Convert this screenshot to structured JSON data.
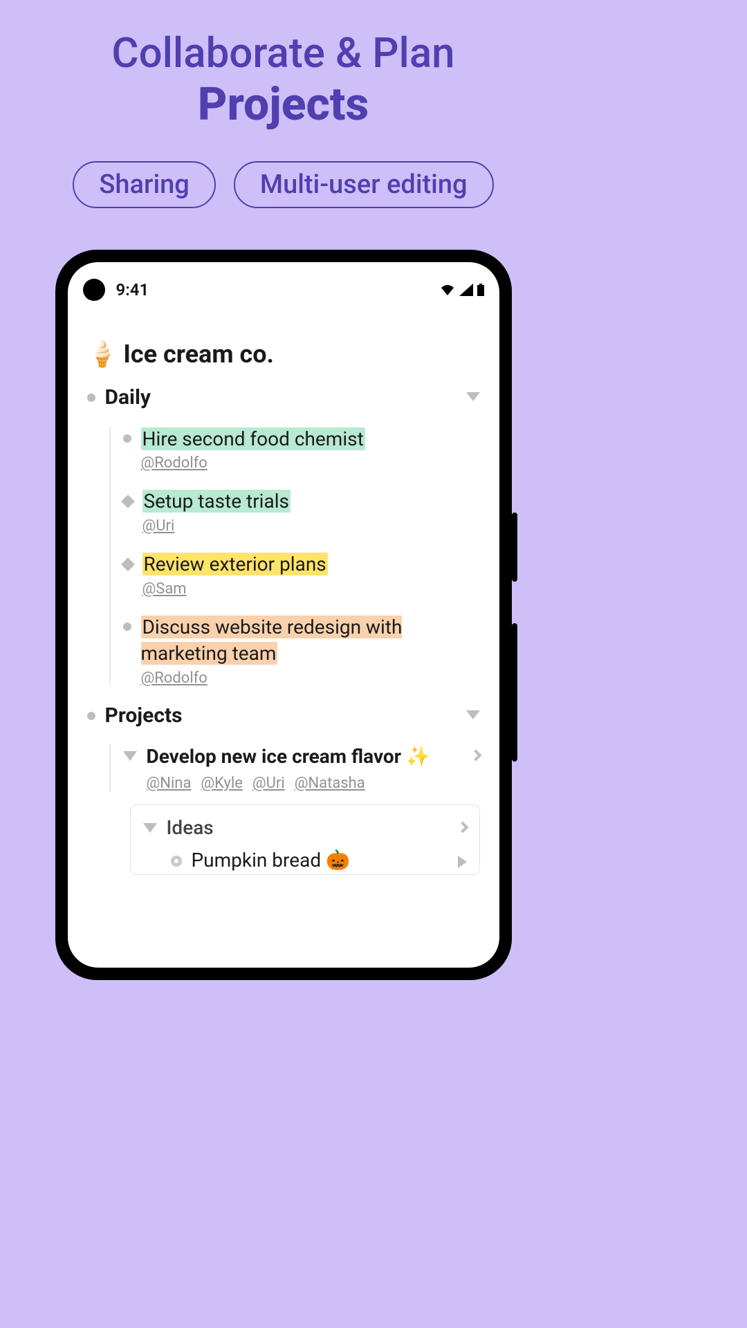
{
  "hero": {
    "title": "Collaborate & Plan",
    "emphasis": "Projects",
    "chips": [
      "Sharing",
      "Multi-user editing"
    ]
  },
  "statusbar": {
    "time": "9:41"
  },
  "doc": {
    "icon": "🍦",
    "title": "Ice cream co.",
    "sections": [
      {
        "name": "Daily",
        "items": [
          {
            "text": "Hire second food chemist",
            "mention": "@Rodolfo",
            "highlight": "green",
            "bullet": "dot"
          },
          {
            "text": "Setup taste trials",
            "mention": "@Uri",
            "highlight": "green",
            "bullet": "diamond"
          },
          {
            "text": "Review exterior plans",
            "mention": "@Sam",
            "highlight": "yellow",
            "bullet": "diamond"
          },
          {
            "text": "Discuss website redesign with marketing team",
            "mention": "@Rodolfo",
            "highlight": "orange",
            "bullet": "dot"
          }
        ]
      },
      {
        "name": "Projects",
        "project": {
          "title_pre": "Develop new ice cream flavor ",
          "sparkle": "✨",
          "mentions": [
            "@Nina",
            "@Kyle",
            "@Uri",
            "@Natasha"
          ],
          "ideas_label": "Ideas",
          "idea_item": "Pumpkin bread 🎃"
        }
      }
    ]
  }
}
